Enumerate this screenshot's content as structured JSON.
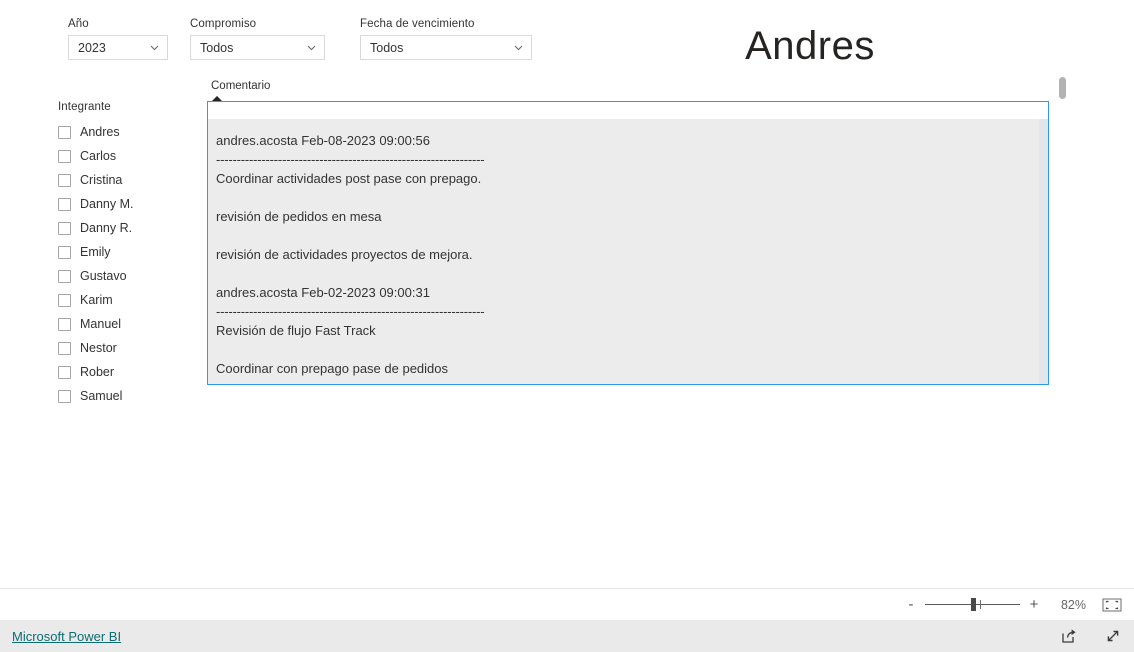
{
  "title": "Andres",
  "slicers": [
    {
      "label": "Año",
      "value": "2023",
      "icon": "chevron-down-icon"
    },
    {
      "label": "Compromiso",
      "value": "Todos",
      "icon": "chevron-down-icon"
    },
    {
      "label": "Fecha de vencimiento",
      "value": "Todos",
      "icon": "chevron-down-icon"
    }
  ],
  "integrante": {
    "title": "Integrante",
    "items": [
      {
        "label": "Andres",
        "checked": false
      },
      {
        "label": "Carlos",
        "checked": false
      },
      {
        "label": "Cristina",
        "checked": false
      },
      {
        "label": "Danny M.",
        "checked": false
      },
      {
        "label": "Danny R.",
        "checked": false
      },
      {
        "label": "Emily",
        "checked": false
      },
      {
        "label": "Gustavo",
        "checked": false
      },
      {
        "label": "Karim",
        "checked": false
      },
      {
        "label": "Manuel",
        "checked": false
      },
      {
        "label": "Nestor",
        "checked": false
      },
      {
        "label": "Rober",
        "checked": false
      },
      {
        "label": "Samuel",
        "checked": false
      }
    ]
  },
  "comment_panel": {
    "tab_label": "Comentario",
    "lines": [
      "andres.acosta Feb-08-2023 09:00:56",
      "-----------------------------------------------------------------",
      "Coordinar actividades post pase con prepago.",
      "",
      "revisión de pedidos en mesa",
      "",
      "revisión de actividades proyectos de mejora.",
      "",
      "andres.acosta Feb-02-2023 09:00:31",
      "-----------------------------------------------------------------",
      "Revisión de flujo Fast Track",
      "",
      "Coordinar con prepago pase de pedidos"
    ]
  },
  "statusbar": {
    "zoom_out_label": "-",
    "zoom_in_label": "+",
    "zoom_percent": "82%",
    "fit_icon": "fit-to-page-icon"
  },
  "footer": {
    "brand": "Microsoft Power BI",
    "share_icon": "share-icon",
    "fullscreen_icon": "fullscreen-expand-icon"
  },
  "colors": {
    "accent_blue": "#2b9ae8",
    "link_teal": "#0d6d72",
    "comment_bg": "#ececec"
  }
}
